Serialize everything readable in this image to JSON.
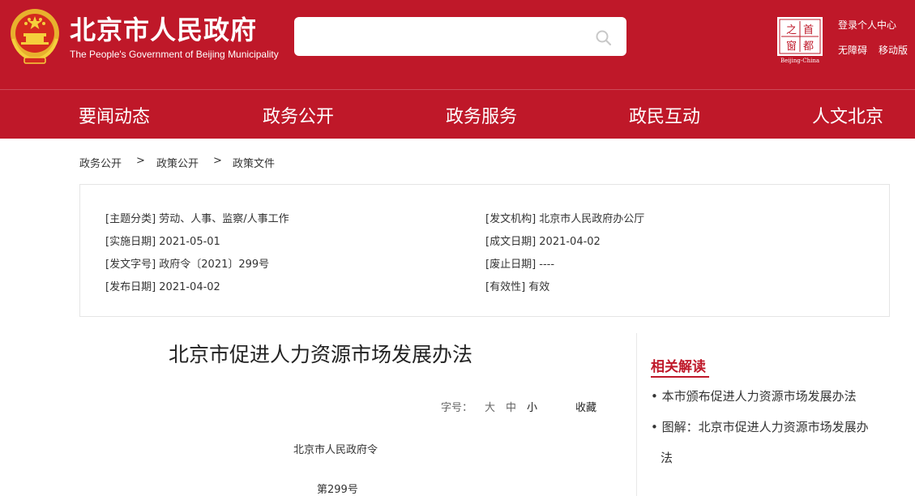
{
  "header": {
    "title": "北京市人民政府",
    "subtitle": "The People's Government of Beijing Municipality",
    "emblem_icon": "national-emblem-icon",
    "capital_logo": {
      "icon": "capital-window-logo-icon",
      "chars": [
        "之",
        "首",
        "窗",
        "都"
      ],
      "caption": "Beijing-China"
    },
    "search": {
      "value": "",
      "placeholder": "",
      "icon": "search-icon"
    },
    "links": {
      "login": "登录个人中心",
      "accessibility": "无障碍",
      "mobile": "移动版"
    },
    "colors": {
      "brand": "#bf1829",
      "text_on_brand": "#ffffff"
    }
  },
  "nav": {
    "items": [
      "要闻动态",
      "政务公开",
      "政务服务",
      "政民互动",
      "人文北京"
    ]
  },
  "breadcrumb": {
    "items": [
      "政务公开",
      "政策公开",
      "政策文件"
    ],
    "separator": ">"
  },
  "meta": {
    "topic": "[主题分类] 劳动、人事、监察/人事工作",
    "issuer": "[发文机构] 北京市人民政府办公厅",
    "effective_date": "[实施日期] 2021-05-01",
    "written_date": "[成文日期] 2021-04-02",
    "doc_number": "[发文字号] 政府令〔2021〕299号",
    "repeal_date": "[废止日期] ----",
    "publish_date": "[发布日期] 2021-04-02",
    "validity": "[有效性] 有效"
  },
  "article": {
    "title": "北京市促进人力资源市场发展办法",
    "font_size_label": "字号：",
    "font_sizes": [
      "大",
      "中",
      "小"
    ],
    "favorite": "收藏",
    "lines": [
      "北京市人民政府令",
      "第299号"
    ]
  },
  "sidebar": {
    "title": "相关解读",
    "links": [
      "• 本市颁布促进人力资源市场发展办法",
      "• 图解：北京市促进人力资源市场发展办",
      "法"
    ]
  }
}
